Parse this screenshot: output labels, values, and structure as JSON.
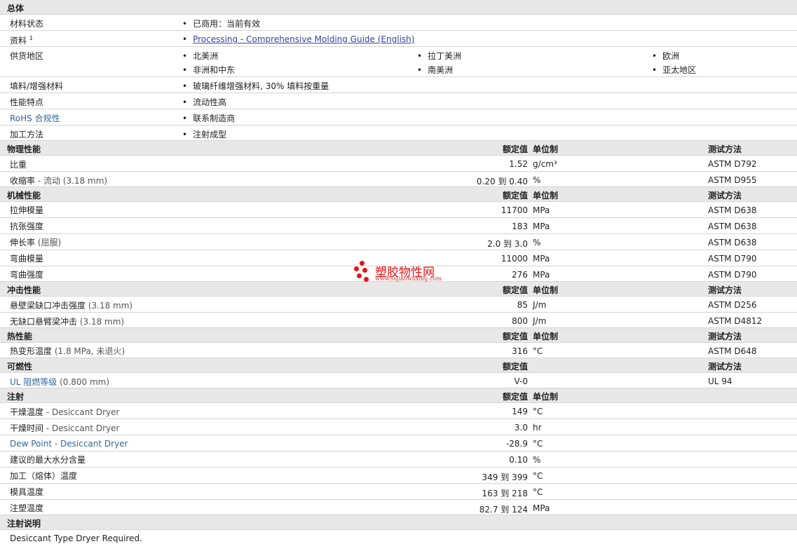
{
  "general": {
    "title": "总体",
    "material_status_label": "材料状态",
    "material_status_value": "已商用：当前有效",
    "docs_label": "资料",
    "docs_sup": "1",
    "docs_link": "Processing - Comprehensive Molding Guide (English)",
    "supply_label": "供货地区",
    "regions": [
      "北美洲",
      "拉丁美洲",
      "欧洲",
      "非洲和中东",
      "南美洲",
      "亚太地区"
    ],
    "filler_label": "填料/增强材料",
    "filler_value": "玻璃纤维增强材料, 30% 填料按重量",
    "features_label": "性能特点",
    "features_value": "流动性高",
    "rohs_label": "RoHS 合规性",
    "rohs_value": "联系制造商",
    "process_label": "加工方法",
    "process_value": "注射成型"
  },
  "headers": {
    "rated": "额定值",
    "unit": "单位制",
    "method": "测试方法"
  },
  "physical": {
    "title": "物理性能",
    "rows": [
      {
        "label": "比重",
        "note": "",
        "value": "1.52",
        "unit": "g/cm³",
        "method": "ASTM D792"
      },
      {
        "label": "收缩率",
        "note": " - 流动  (3.18 mm)",
        "value": "0.20 到  0.40",
        "unit": "%",
        "method": "ASTM D955"
      }
    ]
  },
  "mechanical": {
    "title": "机械性能",
    "rows": [
      {
        "label": "拉伸模量",
        "note": "",
        "value": "11700",
        "unit": "MPa",
        "method": "ASTM D638"
      },
      {
        "label": "抗张强度",
        "note": "",
        "value": "183",
        "unit": "MPa",
        "method": "ASTM D638"
      },
      {
        "label": "伸长率",
        "note": "  (屈服)",
        "value": "2.0 到  3.0",
        "unit": "%",
        "method": "ASTM D638"
      },
      {
        "label": "弯曲模量",
        "note": "",
        "value": "11000",
        "unit": "MPa",
        "method": "ASTM D790"
      },
      {
        "label": "弯曲强度",
        "note": "",
        "value": "276",
        "unit": "MPa",
        "method": "ASTM D790"
      }
    ]
  },
  "impact": {
    "title": "冲击性能",
    "rows": [
      {
        "label": "悬壁梁缺口冲击强度",
        "note": "  (3.18 mm)",
        "value": "85",
        "unit": "J/m",
        "method": "ASTM D256"
      },
      {
        "label": "无缺口悬臂梁冲击",
        "note": "  (3.18 mm)",
        "value": "800",
        "unit": "J/m",
        "method": "ASTM D4812"
      }
    ]
  },
  "thermal": {
    "title": "热性能",
    "rows": [
      {
        "label": "热变形温度",
        "note": "  (1.8 MPa, 未退火)",
        "value": "316",
        "unit": "°C",
        "method": "ASTM D648"
      }
    ]
  },
  "flammability": {
    "title": "可燃性",
    "rows": [
      {
        "label": "UL 阻燃等级",
        "note": "  (0.800 mm)",
        "value": "V-0",
        "unit": "",
        "method": "UL 94"
      }
    ]
  },
  "injection": {
    "title": "注射",
    "rows": [
      {
        "label": "干燥温度",
        "note": "  - Desiccant Dryer",
        "value": "149",
        "unit": "°C"
      },
      {
        "label": "干燥时间",
        "note": "  - Desiccant Dryer",
        "value": "3.0",
        "unit": "hr"
      },
      {
        "label": "Dew Point - Desiccant Dryer",
        "note": "",
        "value": "-28.9",
        "unit": "°C"
      },
      {
        "label": "建议的最大水分含量",
        "note": "",
        "value": "0.10",
        "unit": "%"
      },
      {
        "label": "加工（熔体）温度",
        "note": "",
        "value": "349 到  399",
        "unit": "°C"
      },
      {
        "label": "模具温度",
        "note": "",
        "value": "163 到  218",
        "unit": "°C"
      },
      {
        "label": "注塑温度",
        "note": "",
        "value": "82.7 到  124",
        "unit": "MPa"
      }
    ]
  },
  "notes": {
    "title": "注射说明",
    "text": "Desiccant Type Dryer Required."
  },
  "watermark": {
    "text": "塑胶物性网",
    "url": "www.sujiaowuxing.com",
    "color": "#e11111"
  }
}
